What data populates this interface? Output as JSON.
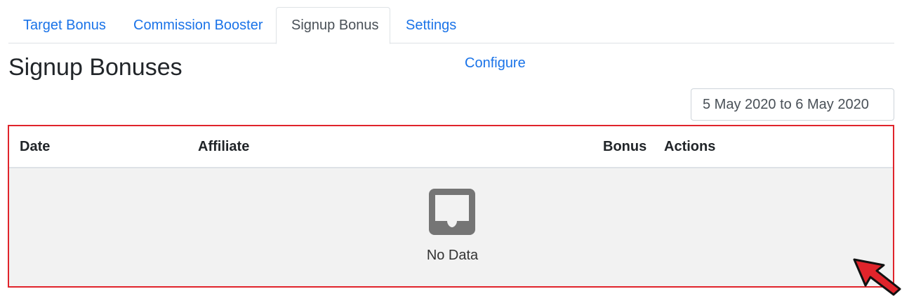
{
  "tabs": [
    {
      "label": "Target Bonus",
      "active": false
    },
    {
      "label": "Commission Booster",
      "active": false
    },
    {
      "label": "Signup Bonus",
      "active": true
    },
    {
      "label": "Settings",
      "active": false
    }
  ],
  "header": {
    "title": "Signup Bonuses",
    "configure_label": "Configure",
    "date_range_value": "5 May 2020 to 6 May 2020"
  },
  "table": {
    "columns": [
      "Date",
      "Affiliate",
      "Bonus",
      "Actions"
    ],
    "rows": [],
    "empty_icon": "inbox-icon",
    "empty_text": "No Data"
  },
  "annotation": {
    "icon": "arrow-icon",
    "highlight_color": "#e0242b"
  },
  "colors": {
    "link": "#1a73e8",
    "highlight": "#e0242b",
    "empty_background": "#f2f2f2",
    "empty_icon": "#757575"
  }
}
